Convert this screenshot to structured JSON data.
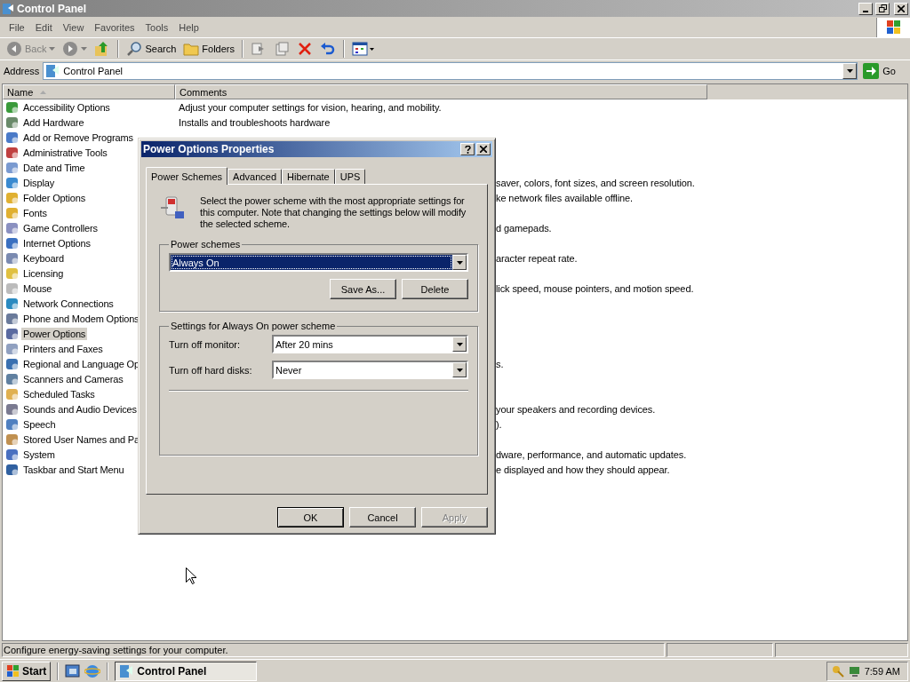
{
  "window": {
    "title": "Control Panel"
  },
  "menu": [
    "File",
    "Edit",
    "View",
    "Favorites",
    "Tools",
    "Help"
  ],
  "toolbar": [
    {
      "kind": "back",
      "label": "Back",
      "disabled": true
    },
    {
      "kind": "forward",
      "disabled": true
    },
    {
      "kind": "up",
      "disabled": false
    },
    {
      "kind": "search",
      "label": "Search",
      "disabled": false
    },
    {
      "kind": "folders",
      "label": "Folders",
      "disabled": false
    },
    {
      "kind": "move",
      "disabled": true
    },
    {
      "kind": "copy",
      "disabled": true
    },
    {
      "kind": "delete",
      "disabled": false
    },
    {
      "kind": "undo",
      "disabled": false
    },
    {
      "kind": "views",
      "disabled": false
    }
  ],
  "address": {
    "label": "Address",
    "value": "Control Panel",
    "go": "Go"
  },
  "columns": [
    {
      "label": "Name",
      "sorted": true
    },
    {
      "label": "Comments",
      "sorted": false
    }
  ],
  "items": [
    {
      "name": "Accessibility Options",
      "selected": false,
      "comment": "Adjust your computer settings for vision, hearing, and mobility."
    },
    {
      "name": "Add Hardware",
      "selected": false,
      "comment": "Installs and troubleshoots hardware"
    },
    {
      "name": "Add or Remove Programs",
      "selected": false
    },
    {
      "name": "Administrative Tools",
      "selected": false
    },
    {
      "name": "Date and Time",
      "selected": false
    },
    {
      "name": "Display",
      "selected": false,
      "comment": "saver, colors, font sizes, and screen resolution.",
      "comment_cut": true
    },
    {
      "name": "Folder Options",
      "selected": false,
      "comment": "ke network files available offline.",
      "comment_cut": true
    },
    {
      "name": "Fonts",
      "selected": false
    },
    {
      "name": "Game Controllers",
      "selected": false,
      "comment": "d gamepads.",
      "comment_cut": true
    },
    {
      "name": "Internet Options",
      "selected": false
    },
    {
      "name": "Keyboard",
      "selected": false,
      "comment": "aracter repeat rate.",
      "comment_cut": true
    },
    {
      "name": "Licensing",
      "selected": false
    },
    {
      "name": "Mouse",
      "selected": false,
      "comment": "lick speed, mouse pointers, and motion speed.",
      "comment_cut": true
    },
    {
      "name": "Network Connections",
      "selected": false
    },
    {
      "name": "Phone and Modem Options",
      "selected": false
    },
    {
      "name": "Power Options",
      "selected": true
    },
    {
      "name": "Printers and Faxes",
      "selected": false
    },
    {
      "name": "Regional and Language Op",
      "selected": false,
      "comment": "s.",
      "comment_cut": true
    },
    {
      "name": "Scanners and Cameras",
      "selected": false
    },
    {
      "name": "Scheduled Tasks",
      "selected": false
    },
    {
      "name": "Sounds and Audio Devices",
      "selected": false,
      "comment": "your speakers and recording devices.",
      "comment_cut": true
    },
    {
      "name": "Speech",
      "selected": false,
      "comment": ").",
      "comment_cut": true
    },
    {
      "name": "Stored User Names and Pa",
      "selected": false
    },
    {
      "name": "System",
      "selected": false,
      "comment": "dware, performance, and automatic updates.",
      "comment_cut": true
    },
    {
      "name": "Taskbar and Start Menu",
      "selected": false,
      "comment": "e displayed and how they should appear.",
      "comment_cut": true
    }
  ],
  "dialog": {
    "title": "Power Options Properties",
    "tabs": [
      {
        "label": "Power Schemes",
        "selected": true
      },
      {
        "label": "Advanced",
        "selected": false
      },
      {
        "label": "Hibernate",
        "selected": false
      },
      {
        "label": "UPS",
        "selected": false
      }
    ],
    "description": "Select the power scheme with the most appropriate settings for this computer. Note that changing the settings below will modify the selected scheme.",
    "schemes_group": {
      "label": "Power schemes",
      "value": "Always On",
      "buttons": [
        "Save As...",
        "Delete"
      ]
    },
    "settings_group": {
      "label": "Settings for Always On power scheme",
      "rows": [
        {
          "label": "Turn off monitor:",
          "value": "After 20 mins"
        },
        {
          "label": "Turn off hard disks:",
          "value": "Never"
        }
      ]
    },
    "buttons": [
      {
        "label": "OK",
        "default": true,
        "disabled": false
      },
      {
        "label": "Cancel",
        "default": false,
        "disabled": false
      },
      {
        "label": "Apply",
        "default": false,
        "disabled": true
      }
    ]
  },
  "status_bar": "Configure energy-saving settings for your computer.",
  "taskbar": {
    "start": "Start",
    "tasks": [
      {
        "label": "Control Panel",
        "selected": true
      }
    ],
    "clock": "7:59 AM"
  }
}
